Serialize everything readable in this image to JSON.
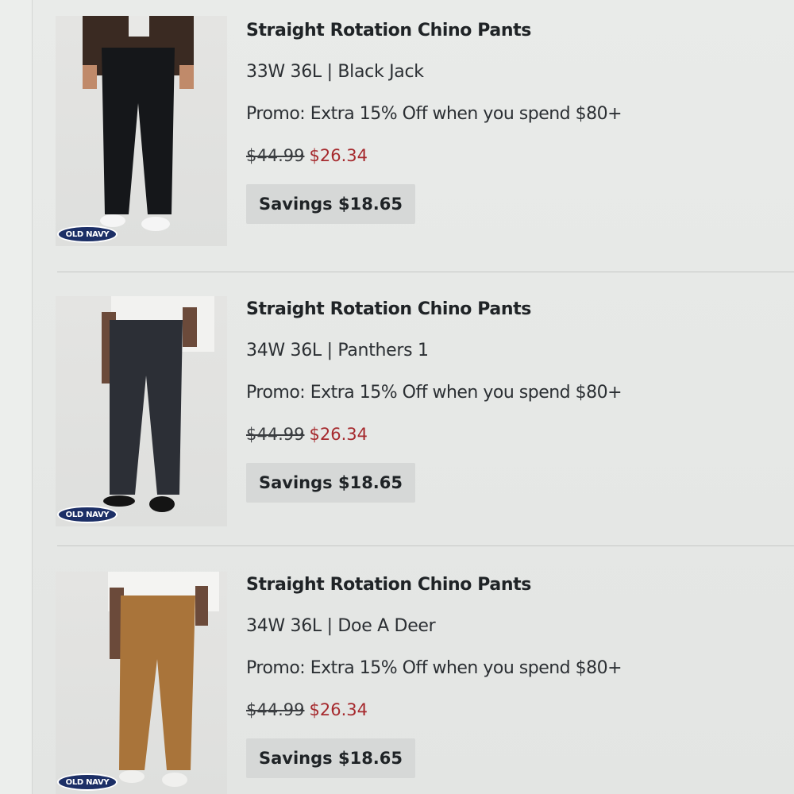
{
  "cart": {
    "items": [
      {
        "title": "Straight Rotation Chino Pants",
        "variant": "33W 36L | Black Jack",
        "promo": "Promo: Extra 15% Off when you spend $80+",
        "original_price": "$44.99",
        "sale_price": "$26.34",
        "savings": "Savings $18.65",
        "brand": "OLD NAVY",
        "pants_color": "#15171a",
        "top_color": "#3a2a22"
      },
      {
        "title": "Straight Rotation Chino Pants",
        "variant": "34W 36L | Panthers 1",
        "promo": "Promo: Extra 15% Off when you spend $80+",
        "original_price": "$44.99",
        "sale_price": "$26.34",
        "savings": "Savings $18.65",
        "brand": "OLD NAVY",
        "pants_color": "#2c2f36",
        "top_color": "#f2f2f0"
      },
      {
        "title": "Straight Rotation Chino Pants",
        "variant": "34W 36L | Doe A Deer",
        "promo": "Promo: Extra 15% Off when you spend $80+",
        "original_price": "$44.99",
        "sale_price": "$26.34",
        "savings": "Savings $18.65",
        "brand": "OLD NAVY",
        "pants_color": "#a9743a",
        "top_color": "#f4f4f2"
      }
    ]
  }
}
